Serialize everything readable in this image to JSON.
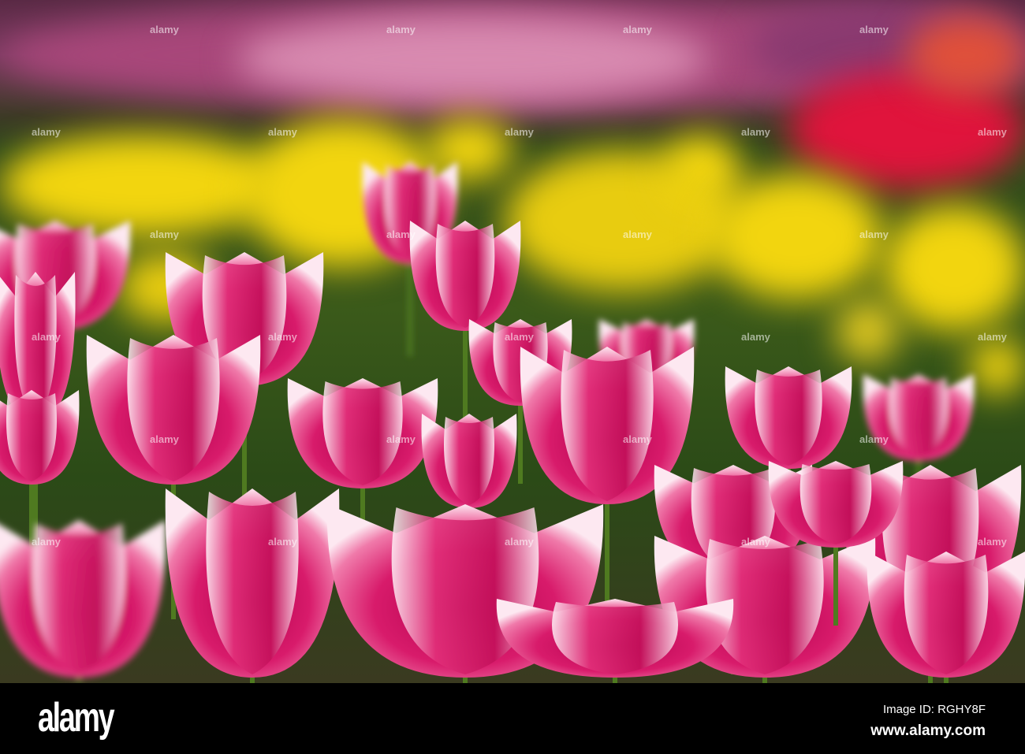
{
  "photo": {
    "subject": "tulips",
    "colors": {
      "pink": "#d81b6b",
      "white": "#fbe9f1",
      "yellow": "#f2d50f",
      "red": "#e0143c",
      "mauve": "#c06a96",
      "green": "#2f4a1c"
    }
  },
  "watermark": {
    "text": "alamy"
  },
  "footer": {
    "logo": "alamy",
    "image_id": "Image ID: RGHY8F",
    "url": "www.alamy.com"
  }
}
